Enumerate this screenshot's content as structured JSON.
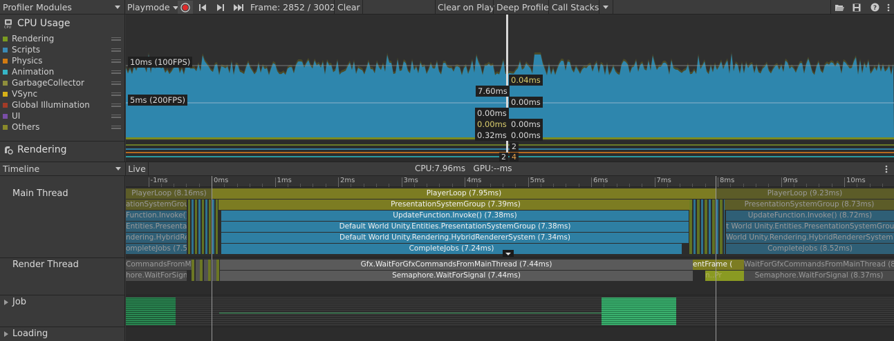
{
  "toolbar": {
    "modules_label": "Profiler Modules",
    "playmode_label": "Playmode",
    "frame_label": "Frame: 2852 / 3002",
    "clear_label": "Clear",
    "clear_on_play_label": "Clear on Play",
    "deep_profile_label": "Deep Profile",
    "call_stacks_label": "Call Stacks"
  },
  "cpu_module": {
    "title": "CPU Usage",
    "legend": [
      {
        "label": "Rendering",
        "color": "#7b9b20"
      },
      {
        "label": "Scripts",
        "color": "#3a8ab5"
      },
      {
        "label": "Physics",
        "color": "#d27b12"
      },
      {
        "label": "Animation",
        "color": "#36b6c8"
      },
      {
        "label": "GarbageCollector",
        "color": "#8e8e3c"
      },
      {
        "label": "VSync",
        "color": "#d6b018"
      },
      {
        "label": "Global Illumination",
        "color": "#a33b27"
      },
      {
        "label": "UI",
        "color": "#7a4ea6"
      },
      {
        "label": "Others",
        "color": "#8a8a2a"
      }
    ],
    "line_10ms": "10ms (100FPS)",
    "line_5ms": "5ms (200FPS)",
    "sel_values_left": [
      "7.60ms",
      "0.00ms",
      "0.00ms",
      "0.32ms"
    ],
    "sel_values_right": [
      "0.04ms",
      "0.00ms",
      "0.00ms",
      "0.00ms"
    ]
  },
  "render_module": {
    "title": "Rendering",
    "val_top": "2",
    "val_left": "2",
    "val_right": "4"
  },
  "timeline_bar": {
    "view_label": "Timeline",
    "live_label": "Live",
    "cpu_gpu_label": "CPU:7.96ms   GPU:--ms"
  },
  "ruler": [
    "-1ms",
    "0ms",
    "1ms",
    "2ms",
    "3ms",
    "4ms",
    "5ms",
    "6ms",
    "7ms",
    "8ms",
    "9ms",
    "10ms"
  ],
  "threads": {
    "main": "Main Thread",
    "render": "Render Thread",
    "job": "Job",
    "loading": "Loading"
  },
  "main_bars": {
    "player_loop": "PlayerLoop (7.95ms)",
    "presentation": "PresentationSystemGroup (7.39ms)",
    "update_invoke": "UpdateFunction.Invoke() (7.38ms)",
    "default_world": "Default World Unity.Entities.PresentationSystemGroup (7.38ms)",
    "hybrid": "Default World Unity.Rendering.HybridRendererSystem (7.34ms)",
    "complete_jobs": "CompleteJobs (7.24ms)",
    "prev_player_loop": "PlayerLoop (8.16ms)",
    "prev_presentation": "ationSystemGroup (",
    "prev_update": "Function.Invoke() (",
    "prev_world": "Entities.Presentation",
    "prev_hybrid": "ndering.HybridRen",
    "prev_complete": "ompleteJobs (7.50",
    "next_player_loop": "PlayerLoop (9.23ms)",
    "next_presentation": "PresentationSystemGroup (8.73ms)",
    "next_update": "UpdateFunction.Invoke() (8.72ms)",
    "next_world": "t World Unity.Entities.PresentationSystemGroup (",
    "next_hybrid": "World Unity.Rendering.HybridRendererSystem (",
    "next_complete": "CompleteJobs (8.52ms)"
  },
  "render_bars": {
    "gfx_wait": "Gfx.WaitForGfxCommandsFromMainThread (7.44ms)",
    "semaphore": "Semaphore.WaitForSignal (7.44ms)",
    "prev_gfx": "CommandsFromMain",
    "prev_sem": "hore.WaitForSignal (",
    "frame_end": "entFrame (",
    "next_gfx": "WaitForGfxCommandsFromMainThread (8.3",
    "next_sem": "Semaphore.WaitForSignal (8.37ms)",
    "next_small": "n..Pr"
  },
  "colors": {
    "olive": "#7c7c22",
    "olive_dim": "#5c5c28",
    "blue": "#2e7fa3",
    "blue_dim": "#2f5f76",
    "gray": "#5a5a5a",
    "gray_dim": "#4a4a4a"
  }
}
